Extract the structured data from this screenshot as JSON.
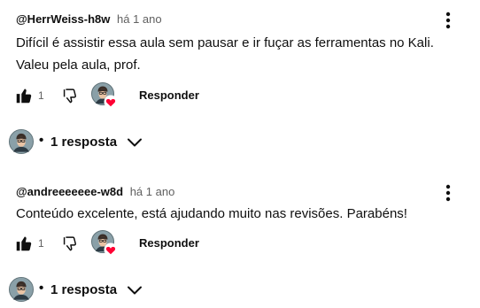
{
  "comments": [
    {
      "author": "@HerrWeiss-h8w",
      "time": "há 1 ano",
      "text": "Difícil é assistir essa aula sem pausar e ir fuçar as ferramentas no Kali. Valeu pela aula, prof.",
      "likes": "1",
      "reply_label": "Responder",
      "replies_label": "1 resposta"
    },
    {
      "author": "@andreeeeeee-w8d",
      "time": "há 1 ano",
      "text": "Conteúdo excelente, está ajudando muito nas revisões. Parabéns!",
      "likes": "1",
      "reply_label": "Responder",
      "replies_label": "1 resposta"
    }
  ],
  "icons": {
    "more": "vertical-dots-icon",
    "like": "thumbs-up-icon",
    "dislike": "thumbs-down-icon",
    "creator_heart": "heart-icon",
    "expand": "chevron-down-icon",
    "separator": "•"
  },
  "colors": {
    "text": "#0f0f0f",
    "secondary": "#606060",
    "heart": "#ff0033"
  }
}
